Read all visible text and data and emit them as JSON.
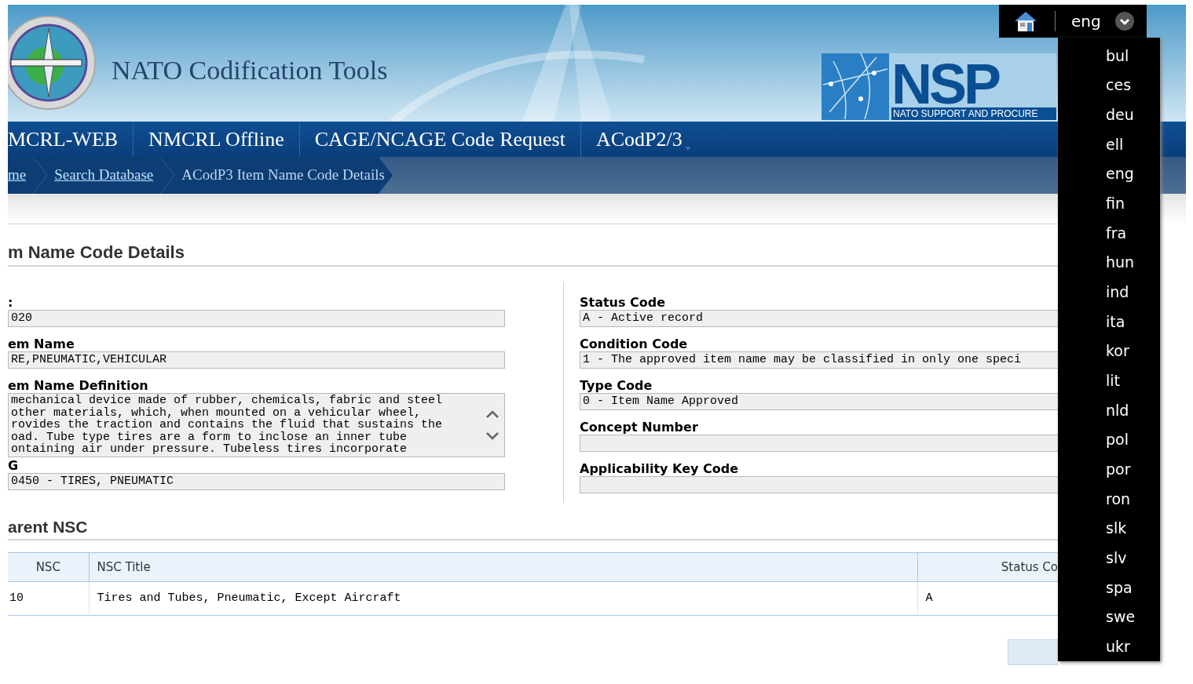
{
  "header": {
    "title": "NATO Codification Tools",
    "partner_logo": {
      "mark": "NSP",
      "tagline": "NATO SUPPORT AND PROCURE"
    }
  },
  "top_bar": {
    "language": "eng"
  },
  "language_menu": [
    "bul",
    "ces",
    "deu",
    "ell",
    "eng",
    "fin",
    "fra",
    "hun",
    "ind",
    "ita",
    "kor",
    "lit",
    "nld",
    "pol",
    "por",
    "ron",
    "slk",
    "slv",
    "spa",
    "swe",
    "ukr"
  ],
  "nav": [
    {
      "label": "MCRL-WEB"
    },
    {
      "label": "NMCRL Offline"
    },
    {
      "label": "CAGE/NCAGE Code Request"
    },
    {
      "label": "ACodP2/3",
      "has_menu": true
    }
  ],
  "breadcrumbs": [
    {
      "label": "me",
      "link": true
    },
    {
      "label": "Search Database",
      "link": true
    },
    {
      "label": "ACodP3 Item Name Code Details",
      "link": false
    }
  ],
  "section_title": "m Name Code Details",
  "left_fields": [
    {
      "kind": "line",
      "label": ":",
      "value": "020"
    },
    {
      "kind": "line",
      "label": "em Name",
      "value": "RE,PNEUMATIC,VEHICULAR"
    },
    {
      "kind": "area",
      "label": "em Name Definition",
      "lines": [
        "mechanical device made of rubber, chemicals, fabric and steel",
        "other materials, which, when mounted on a vehicular wheel,",
        "rovides the traction and contains the fluid that sustains the",
        "oad. Tube type tires are a form to inclose an inner tube",
        "ontaining air under pressure. Tubeless tires incorporate"
      ]
    },
    {
      "kind": "line",
      "label": "G",
      "value": "0450 - TIRES, PNEUMATIC"
    }
  ],
  "right_fields": [
    {
      "label": "Status Code",
      "value": "A - Active record"
    },
    {
      "label": "Condition Code",
      "value": "1 - The approved item name may be classified in only one speci"
    },
    {
      "label": "Type Code",
      "value": "0 - Item Name Approved"
    },
    {
      "label": "Concept Number"
    },
    {
      "label": "Applicability Key Code"
    }
  ],
  "parent_title": "arent NSC",
  "table": {
    "columns": [
      "NSC",
      "NSC Title",
      "Status Co"
    ],
    "rows": [
      [
        "10",
        "Tires and Tubes, Pneumatic, Except Aircraft",
        "A"
      ]
    ]
  }
}
